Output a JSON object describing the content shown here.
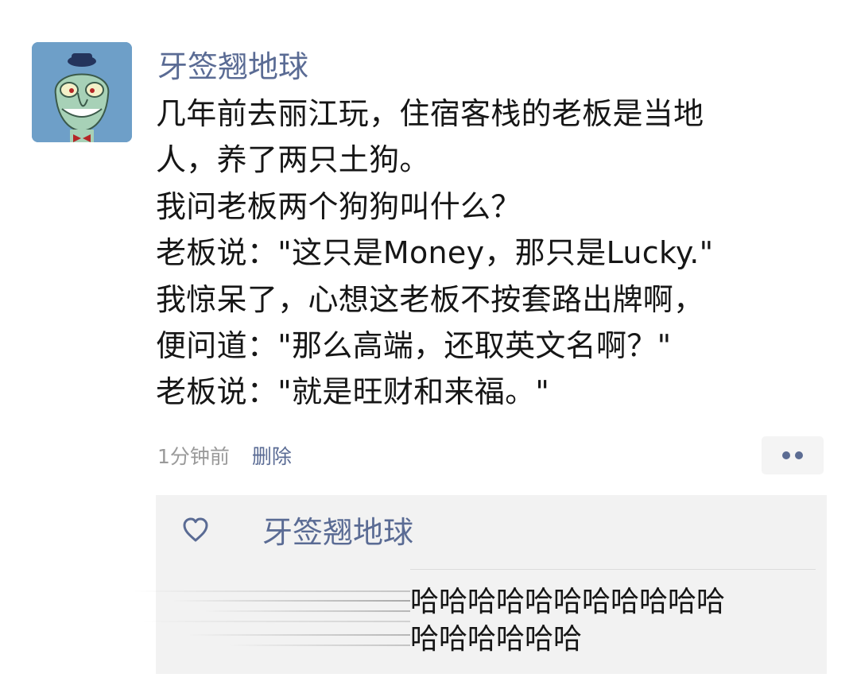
{
  "post": {
    "author": "牙签翘地球",
    "lines": [
      "几年前去丽江玩，住宿客栈的老板是当地",
      "人，养了两只土狗。",
      "我问老板两个狗狗叫什么？",
      "老板说：\"这只是Money，那只是Lucky.\"",
      "我惊呆了，心想这老板不按套路出牌啊，",
      "便问道：\"那么高端，还取英文名啊？\"",
      "老板说：\"就是旺财和来福。\""
    ],
    "time": "1分钟前",
    "delete_label": "删除",
    "more_icon": "more-dots-icon"
  },
  "likes": {
    "icon": "heart-icon",
    "users": "牙签翘地球"
  },
  "comment": {
    "lines": [
      "哈哈哈哈哈哈哈哈哈哈哈",
      "哈哈哈哈哈哈"
    ]
  },
  "colors": {
    "link": "#5a6b94",
    "text": "#161616",
    "meta": "#9a9a9a",
    "panel_bg": "#f2f2f2",
    "avatar_bg": "#6e9fc8"
  }
}
